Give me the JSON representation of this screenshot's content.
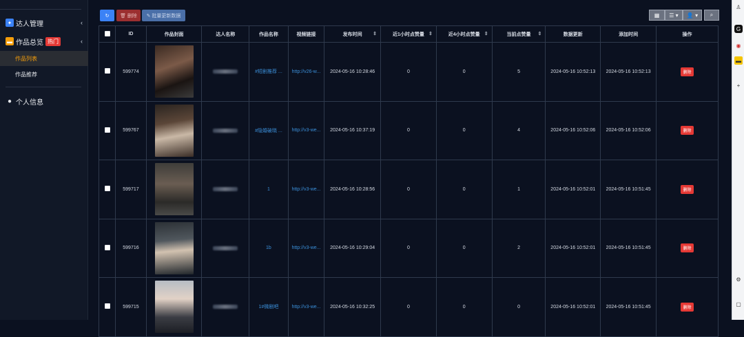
{
  "sidebar": {
    "group1": {
      "label": "达人管理",
      "icon": "gear-icon",
      "chevron": "‹"
    },
    "group2": {
      "label": "作品总览",
      "icon": "folder-icon",
      "badge": "热门",
      "chevron": "‹"
    },
    "sub": [
      {
        "label": "作品列表",
        "active": true
      },
      {
        "label": "作品推荐",
        "active": false
      }
    ],
    "profile": {
      "label": "个人信息",
      "icon": "user-icon"
    }
  },
  "toolbar": {
    "refresh_icon": "↻",
    "delete_label": "🗑 删除",
    "batch_label": "✎ 批量更新数据",
    "right_buttons": [
      "▦",
      "☰ ▾",
      "👤 ▾",
      "⌕"
    ]
  },
  "table": {
    "headers": [
      "ID",
      "作品封面",
      "达人名称",
      "作品名称",
      "视频链接",
      "发布时间",
      "近1小时点赞量",
      "近4小时点赞量",
      "当前点赞量",
      "数据更新",
      "添加时间",
      "操作"
    ],
    "rows": [
      {
        "id": "599774",
        "name": "#短剧推荐 ...",
        "link": "http://v26-w...",
        "publish": "2024-05-16 10:28:46",
        "h1": "0",
        "h4": "0",
        "current": "5",
        "updated": "2024-05-16 10:52:13",
        "added": "2024-05-16 10:52:13",
        "action": "删除"
      },
      {
        "id": "599767",
        "name": "#隐婚破晓 ...",
        "link": "http://v3-we...",
        "publish": "2024-05-16 10:37:19",
        "h1": "0",
        "h4": "0",
        "current": "4",
        "updated": "2024-05-16 10:52:06",
        "added": "2024-05-16 10:52:06",
        "action": "删除"
      },
      {
        "id": "599717",
        "name": "1",
        "link": "http://v3-we...",
        "publish": "2024-05-16 10:28:56",
        "h1": "0",
        "h4": "0",
        "current": "1",
        "updated": "2024-05-16 10:52:01",
        "added": "2024-05-16 10:51:45",
        "action": "删除"
      },
      {
        "id": "599716",
        "name": "1b",
        "link": "http://v3-we...",
        "publish": "2024-05-16 10:29:04",
        "h1": "0",
        "h4": "0",
        "current": "2",
        "updated": "2024-05-16 10:52:01",
        "added": "2024-05-16 10:51:45",
        "action": "删除"
      },
      {
        "id": "599715",
        "name": "1#微剧吧",
        "link": "http://v3-we...",
        "publish": "2024-05-16 10:32:25",
        "h1": "0",
        "h4": "0",
        "current": "0",
        "updated": "2024-05-16 10:52:01",
        "added": "2024-05-16 10:51:45",
        "action": "删除"
      }
    ]
  },
  "colors": {
    "accent_blue": "#3b8fd9",
    "danger": "#e53935",
    "hot": "#f59e0b"
  }
}
